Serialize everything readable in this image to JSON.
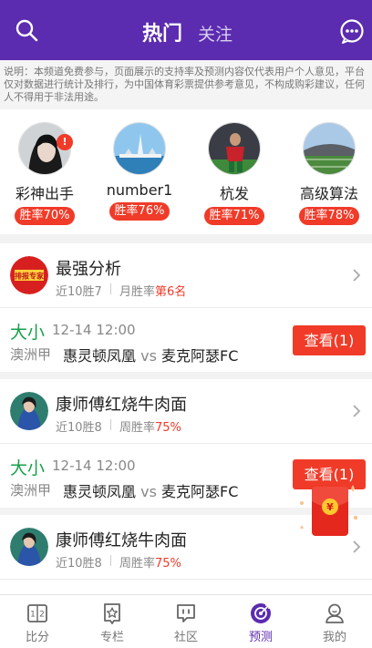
{
  "header": {
    "tabs": [
      {
        "label": "热门",
        "active": true
      },
      {
        "label": "关注",
        "active": false
      }
    ],
    "search_icon": "search-icon",
    "message_icon": "chat-bubble-icon"
  },
  "disclaimer": "说明：本频道免费参与，页面展示的支持率及预测内容仅代表用户个人意见，平台仅对数据进行统计及排行，为中国体育彩票提供参考意见，不构成购彩建议，任何人不得用于非法用途。",
  "experts": [
    {
      "name": "彩神出手",
      "rate": "胜率70%",
      "badge": "!"
    },
    {
      "name": "number1",
      "rate": "胜率76%"
    },
    {
      "name": "杭发",
      "rate": "胜率71%"
    },
    {
      "name": "高级算法",
      "rate": "胜率78%"
    }
  ],
  "cards": [
    {
      "author": "最强分析",
      "recent": "近10胜7",
      "rank_label": "月胜率",
      "rank_value": "第6名",
      "avatar_text": "排报专家",
      "pick": {
        "type": "大小",
        "time": "12-14 12:00",
        "league": "澳洲甲",
        "home": "惠灵顿凤凰",
        "vs": "vs",
        "away": "麦克阿瑟FC",
        "button": "查看(1)"
      }
    },
    {
      "author": "康师傅红烧牛肉面",
      "recent": "近10胜8",
      "rank_label": "周胜率",
      "rank_value": "75%",
      "pick": {
        "type": "大小",
        "time": "12-14 12:00",
        "league": "澳洲甲",
        "home": "惠灵顿凤凰",
        "vs": "vs",
        "away": "麦克阿瑟FC",
        "button": "查看(1)"
      }
    },
    {
      "author": "康师傅红烧牛肉面",
      "recent": "近10胜8",
      "rank_label": "周胜率",
      "rank_value": "75%"
    }
  ],
  "envelope": {
    "symbol": "¥"
  },
  "bottom_nav": [
    {
      "label": "比分",
      "icon": "scoreboard-icon",
      "active": false
    },
    {
      "label": "专栏",
      "icon": "star-document-icon",
      "active": false
    },
    {
      "label": "社区",
      "icon": "community-chat-icon",
      "active": false
    },
    {
      "label": "预测",
      "icon": "prediction-target-icon",
      "active": true
    },
    {
      "label": "我的",
      "icon": "profile-icon",
      "active": false
    }
  ],
  "colors": {
    "brand_purple": "#5b2bb0",
    "accent_red": "#f03b28",
    "pick_green": "#1aa04a"
  }
}
